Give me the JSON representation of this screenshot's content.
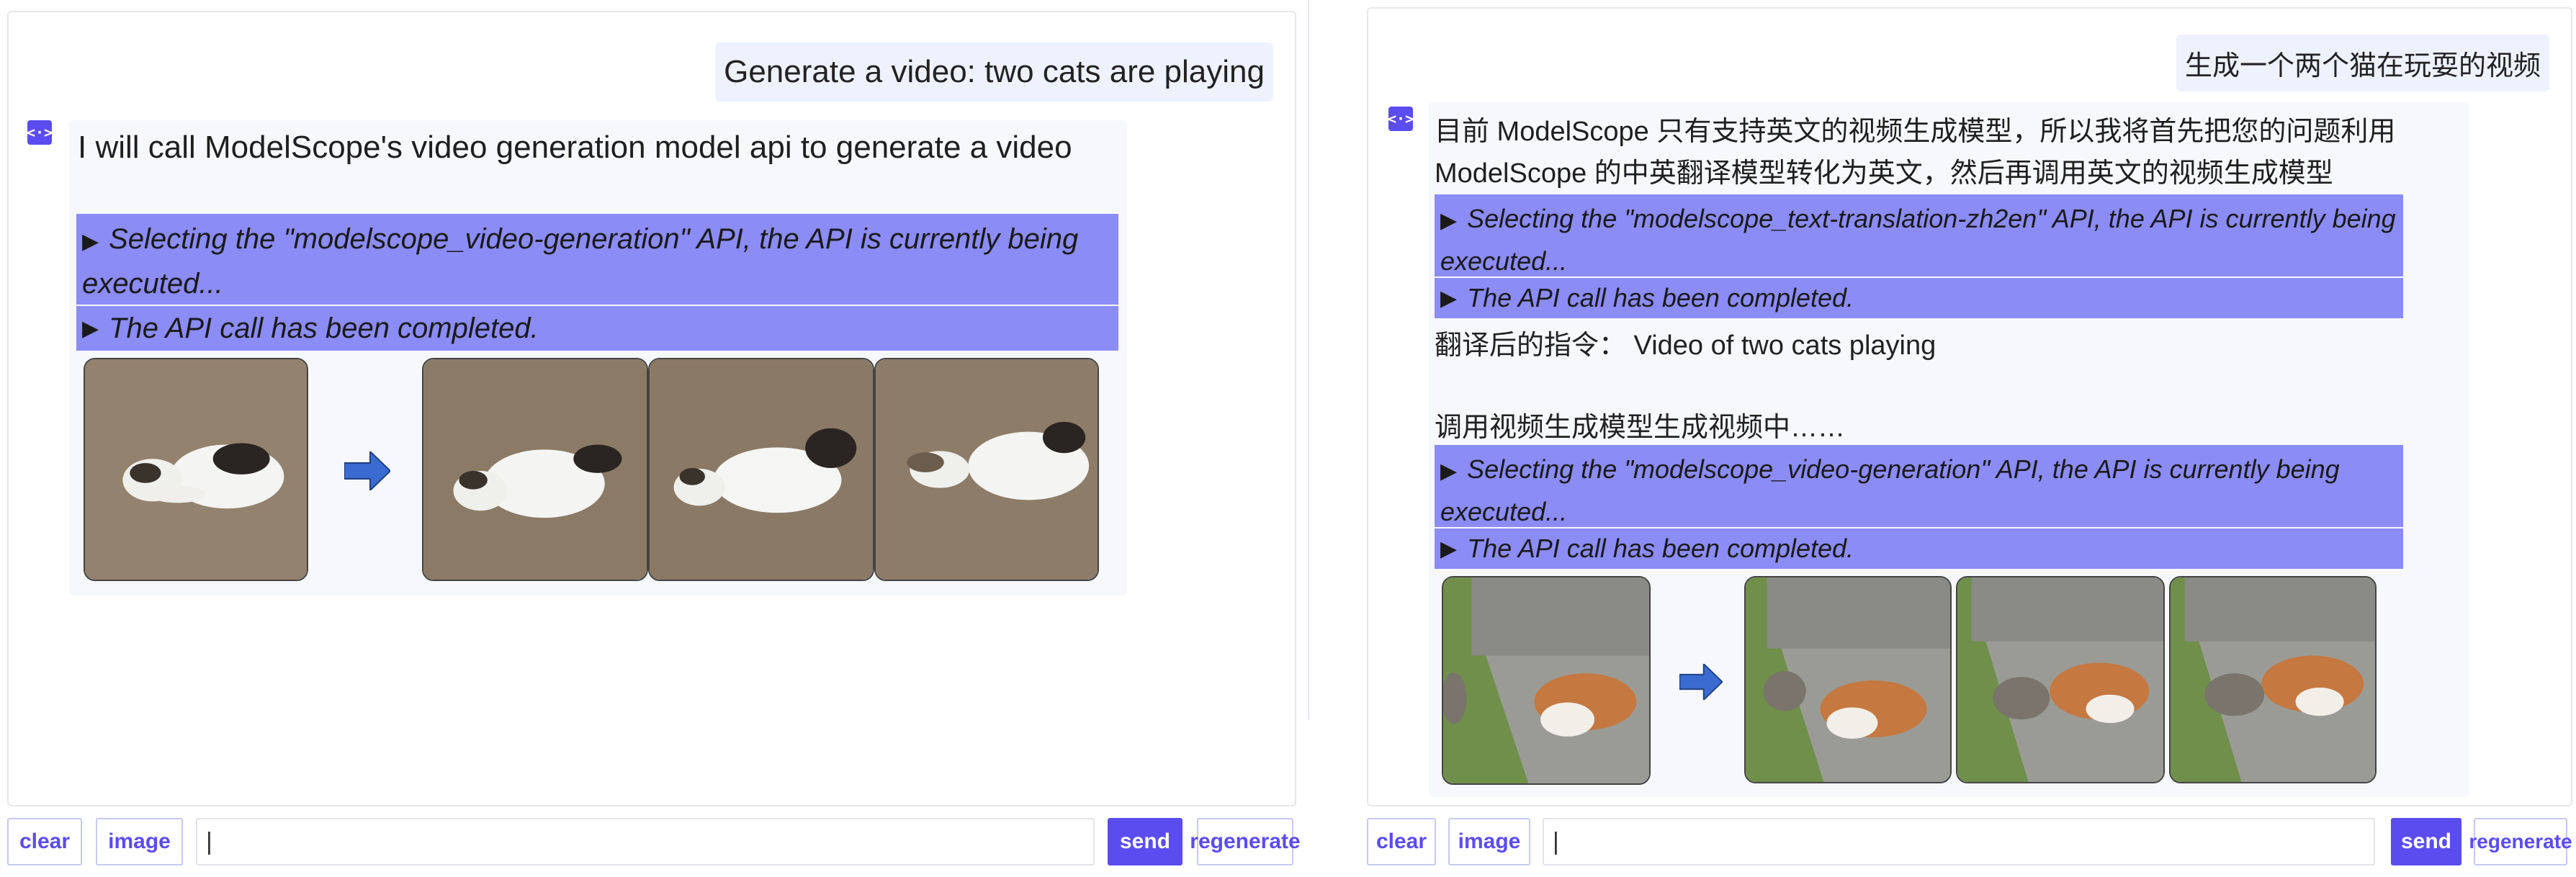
{
  "left": {
    "user_message": "Generate a video: two cats are playing",
    "bot_avatar_glyph": "<·>",
    "bot_text": "I will call ModelScope's video generation model api to generate a video",
    "api_calls": [
      {
        "label": "Selecting the \"modelscope_video-generation\" API, the API is currently being executed..."
      },
      {
        "label": "The API call has been completed."
      }
    ],
    "buttons": {
      "clear": "clear",
      "image": "image",
      "send": "send",
      "regenerate": "regenerate"
    },
    "input_value": "|"
  },
  "right": {
    "user_message": "生成一个两个猫在玩耍的视频",
    "bot_avatar_glyph": "<·>",
    "bot_text": "目前 ModelScope 只有支持英文的视频生成模型，所以我将首先把您的问题利用 ModelScope 的中英翻译模型转化为英文，然后再调用英文的视频生成模型",
    "api_calls": [
      {
        "label": "Selecting the \"modelscope_text-translation-zh2en\" API, the API is currently being executed..."
      },
      {
        "label": "The API call has been completed."
      },
      {
        "label": "Selecting the \"modelscope_video-generation\" API, the API is currently being executed..."
      },
      {
        "label": "The API call has been completed."
      }
    ],
    "translated_line": "翻译后的指令：  Video of two cats playing",
    "calling_line": "调用视频生成模型生成视频中……",
    "buttons": {
      "clear": "clear",
      "image": "image",
      "send": "send",
      "regenerate": "regenerate"
    },
    "input_value": "|"
  },
  "colors": {
    "accent": "#5b4cf0",
    "api_box": "#8b8cf6",
    "user_bubble": "#eef2ff",
    "bot_bubble": "#f7f8fb",
    "arrow": "#3a6bd0"
  },
  "icons": {
    "bot_avatar": "modelscope-logo-icon",
    "arrow": "right-arrow-icon",
    "disclosure": "triangle-right-icon"
  }
}
